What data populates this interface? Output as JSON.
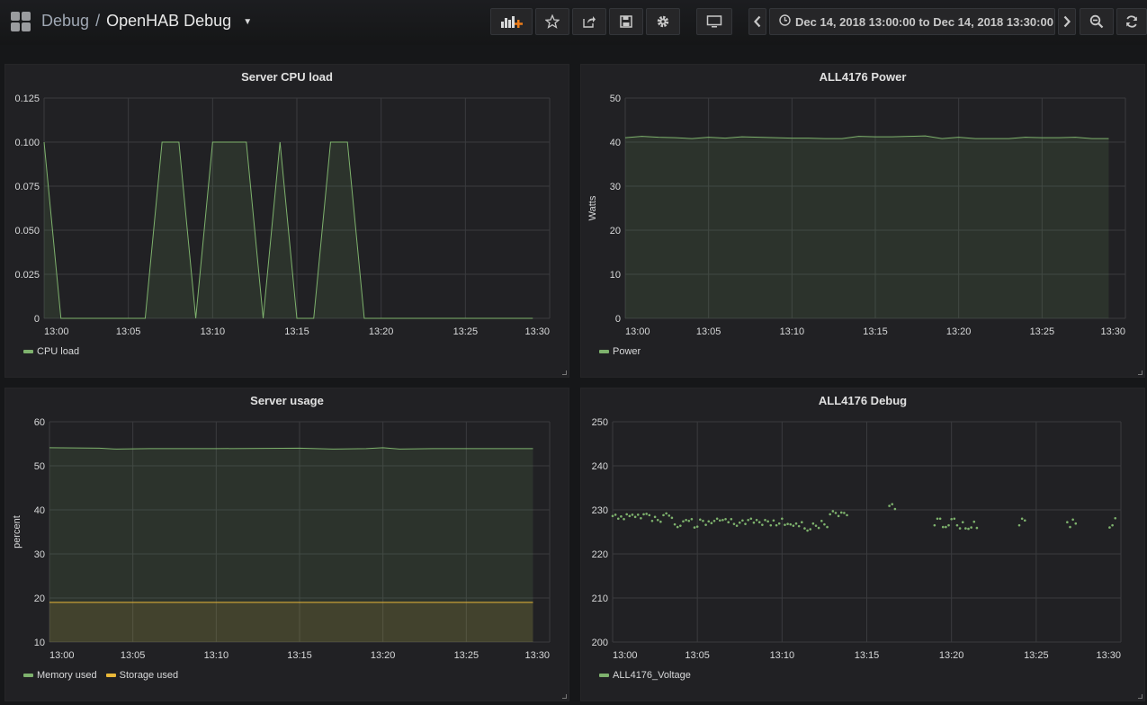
{
  "colors": {
    "green": "#7eb26d",
    "yellow": "#eab839",
    "grid": "#3a3b3e"
  },
  "nav": {
    "folder": "Debug",
    "separator": "/",
    "dashboard": "OpenHAB Debug",
    "time_range": "Dec 14, 2018 13:00:00 to Dec 14, 2018 13:30:00",
    "icons": [
      "apps-icon",
      "add-panel-icon",
      "star-icon",
      "share-icon",
      "save-icon",
      "gear-icon",
      "tv-mode-icon",
      "chevron-left-icon",
      "clock-icon",
      "chevron-right-icon",
      "zoom-out-icon",
      "refresh-icon"
    ]
  },
  "panels": [
    {
      "title": "Server CPU load",
      "chart_data": {
        "type": "area",
        "x_ticks": [
          "13:00",
          "13:05",
          "13:10",
          "13:15",
          "13:20",
          "13:25",
          "13:30"
        ],
        "xlim": [
          "13:00",
          "13:30"
        ],
        "y_ticks": [
          "0",
          "0.025",
          "0.050",
          "0.075",
          "0.100",
          "0.125"
        ],
        "ylim": [
          0,
          0.125
        ],
        "ylabel": "",
        "grid": true,
        "legend_position": "bottom-left",
        "series": [
          {
            "name": "CPU load",
            "color": "#7eb26d",
            "x": [
              "13:00",
              "13:01",
              "13:06",
              "13:07",
              "13:08",
              "13:09",
              "13:10",
              "13:12",
              "13:13",
              "13:14",
              "13:15",
              "13:16",
              "13:17",
              "13:18",
              "13:19",
              "13:29"
            ],
            "y": [
              0.1,
              0,
              0,
              0.1,
              0.1,
              0,
              0.1,
              0.1,
              0,
              0.1,
              0,
              0,
              0.1,
              0.1,
              0,
              0
            ]
          }
        ]
      }
    },
    {
      "title": "ALL4176 Power",
      "chart_data": {
        "type": "area",
        "x_ticks": [
          "13:00",
          "13:05",
          "13:10",
          "13:15",
          "13:20",
          "13:25",
          "13:30"
        ],
        "xlim": [
          "13:00",
          "13:30"
        ],
        "y_ticks": [
          "0",
          "10",
          "20",
          "30",
          "40",
          "50"
        ],
        "ylim": [
          0,
          50
        ],
        "ylabel": "Watts",
        "grid": true,
        "legend_position": "bottom-left",
        "series": [
          {
            "name": "Power",
            "color": "#7eb26d",
            "x": [
              "13:00",
              "13:01",
              "13:02",
              "13:03",
              "13:04",
              "13:05",
              "13:06",
              "13:07",
              "13:08",
              "13:09",
              "13:10",
              "13:11",
              "13:12",
              "13:13",
              "13:14",
              "13:15",
              "13:16",
              "13:17",
              "13:18",
              "13:19",
              "13:20",
              "13:21",
              "13:22",
              "13:23",
              "13:24",
              "13:25",
              "13:26",
              "13:27",
              "13:28",
              "13:29"
            ],
            "y": [
              41.0,
              41.3,
              41.1,
              41.0,
              40.8,
              41.1,
              40.9,
              41.2,
              41.1,
              41.0,
              40.9,
              40.9,
              40.8,
              40.8,
              41.3,
              41.2,
              41.2,
              41.3,
              41.4,
              40.8,
              41.1,
              40.8,
              40.8,
              40.8,
              41.1,
              41.0,
              41.0,
              41.1,
              40.8,
              40.8
            ]
          }
        ]
      }
    },
    {
      "title": "Server usage",
      "chart_data": {
        "type": "area",
        "x_ticks": [
          "13:00",
          "13:05",
          "13:10",
          "13:15",
          "13:20",
          "13:25",
          "13:30"
        ],
        "xlim": [
          "13:00",
          "13:30"
        ],
        "y_ticks": [
          "10",
          "20",
          "30",
          "40",
          "50",
          "60"
        ],
        "ylim": [
          10,
          60
        ],
        "ylabel": "percent",
        "grid": true,
        "legend_position": "bottom-left",
        "series": [
          {
            "name": "Memory used",
            "color": "#7eb26d",
            "x": [
              "13:00",
              "13:03",
              "13:04",
              "13:06",
              "13:10",
              "13:15",
              "13:17",
              "13:19",
              "13:20",
              "13:21",
              "13:23",
              "13:29"
            ],
            "y": [
              54.1,
              54.0,
              53.8,
              53.9,
              53.9,
              54.0,
              53.8,
              53.9,
              54.1,
              53.8,
              53.9,
              53.9
            ]
          },
          {
            "name": "Storage used",
            "color": "#eab839",
            "x": [
              "13:00",
              "13:29"
            ],
            "y": [
              19.0,
              19.0
            ]
          }
        ]
      }
    },
    {
      "title": "ALL4176 Debug",
      "chart_data": {
        "type": "scatter",
        "x_ticks": [
          "13:00",
          "13:05",
          "13:10",
          "13:15",
          "13:20",
          "13:25",
          "13:30"
        ],
        "xlim": [
          "13:00",
          "13:30"
        ],
        "y_ticks": [
          "200",
          "210",
          "220",
          "230",
          "240",
          "250"
        ],
        "ylim": [
          200,
          250
        ],
        "ylabel": "",
        "grid": true,
        "legend_position": "bottom-left",
        "series": [
          {
            "name": "ALL4176_Voltage",
            "color": "#7eb26d",
            "x": [
              "13:00:00",
              "13:00:10",
              "13:00:20",
              "13:00:30",
              "13:00:40",
              "13:00:50",
              "13:01:00",
              "13:01:10",
              "13:01:20",
              "13:01:30",
              "13:01:40",
              "13:01:50",
              "13:02:00",
              "13:02:10",
              "13:02:20",
              "13:02:30",
              "13:02:40",
              "13:02:50",
              "13:03:00",
              "13:03:10",
              "13:03:20",
              "13:03:30",
              "13:03:40",
              "13:03:50",
              "13:04:00",
              "13:04:10",
              "13:04:20",
              "13:04:30",
              "13:04:40",
              "13:04:50",
              "13:05:00",
              "13:05:10",
              "13:05:20",
              "13:05:30",
              "13:05:40",
              "13:05:50",
              "13:06:00",
              "13:06:10",
              "13:06:20",
              "13:06:30",
              "13:06:40",
              "13:06:50",
              "13:07:00",
              "13:07:10",
              "13:07:20",
              "13:07:30",
              "13:07:40",
              "13:07:50",
              "13:08:00",
              "13:08:10",
              "13:08:20",
              "13:08:30",
              "13:08:40",
              "13:08:50",
              "13:09:00",
              "13:09:10",
              "13:09:20",
              "13:09:30",
              "13:09:40",
              "13:09:50",
              "13:10:00",
              "13:10:10",
              "13:10:20",
              "13:10:30",
              "13:10:40",
              "13:10:50",
              "13:11:00",
              "13:11:10",
              "13:11:20",
              "13:11:30",
              "13:11:40",
              "13:11:50",
              "13:12:00",
              "13:12:10",
              "13:12:20",
              "13:12:30",
              "13:12:40",
              "13:12:50",
              "13:13:00",
              "13:13:10",
              "13:13:20",
              "13:13:30",
              "13:13:40",
              "13:13:50",
              "13:16:20",
              "13:16:30",
              "13:16:40",
              "13:19:00",
              "13:19:10",
              "13:19:20",
              "13:19:30",
              "13:19:40",
              "13:19:50",
              "13:20:00",
              "13:20:10",
              "13:20:20",
              "13:20:30",
              "13:20:40",
              "13:20:50",
              "13:21:00",
              "13:21:10",
              "13:21:20",
              "13:21:30",
              "13:24:00",
              "13:24:10",
              "13:24:20",
              "13:26:50",
              "13:27:00",
              "13:27:10",
              "13:27:20",
              "13:29:20",
              "13:29:30",
              "13:29:40"
            ],
            "y": [
              228.6,
              228.9,
              228.0,
              228.5,
              227.9,
              229.0,
              228.6,
              228.9,
              228.4,
              228.9,
              228.1,
              229.0,
              229.1,
              228.8,
              227.5,
              228.4,
              227.7,
              227.3,
              228.8,
              229.2,
              228.7,
              228.2,
              226.7,
              226.1,
              226.4,
              227.4,
              227.7,
              227.5,
              227.9,
              226.0,
              226.2,
              227.8,
              227.5,
              226.6,
              227.4,
              227.0,
              227.5,
              228.0,
              227.6,
              227.7,
              227.9,
              227.2,
              227.9,
              226.8,
              226.4,
              227.1,
              227.6,
              226.8,
              227.7,
              228.0,
              227.1,
              227.7,
              227.2,
              226.6,
              227.7,
              227.4,
              226.5,
              227.6,
              226.5,
              226.9,
              228.0,
              226.6,
              226.8,
              226.7,
              226.4,
              226.9,
              226.3,
              227.2,
              225.8,
              225.3,
              225.6,
              226.9,
              226.4,
              225.9,
              227.5,
              226.7,
              226.1,
              229.0,
              229.7,
              229.3,
              228.6,
              229.4,
              229.3,
              228.8,
              230.9,
              231.3,
              230.2,
              226.5,
              228.0,
              228.0,
              226.1,
              226.1,
              226.5,
              227.9,
              228.0,
              226.5,
              225.8,
              227.2,
              225.8,
              225.7,
              226.0,
              227.3,
              225.9,
              226.5,
              228.0,
              227.6,
              227.2,
              226.1,
              227.8,
              226.9,
              226.0,
              226.5,
              228.1,
              227.0
            ]
          }
        ]
      }
    }
  ]
}
